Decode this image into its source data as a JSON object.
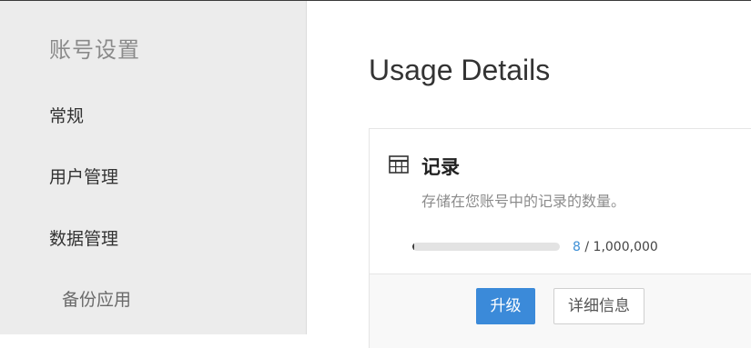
{
  "sidebar": {
    "title": "账号设置",
    "items": [
      {
        "label": "常规"
      },
      {
        "label": "用户管理"
      },
      {
        "label": "数据管理"
      },
      {
        "label": "备份应用"
      }
    ]
  },
  "main": {
    "title": "Usage Details",
    "card": {
      "icon": "table-icon",
      "title": "记录",
      "description": "存储在您账号中的记录的数量。",
      "usage": {
        "used": "8",
        "separator": " / ",
        "limit": "1,000,000",
        "fraction": 8e-06
      },
      "buttons": {
        "upgrade": "升级",
        "details": "详细信息"
      }
    }
  },
  "colors": {
    "accent": "#3b8ad9",
    "used_value": "#3d8fd5",
    "sidebar_bg": "#ececec"
  }
}
